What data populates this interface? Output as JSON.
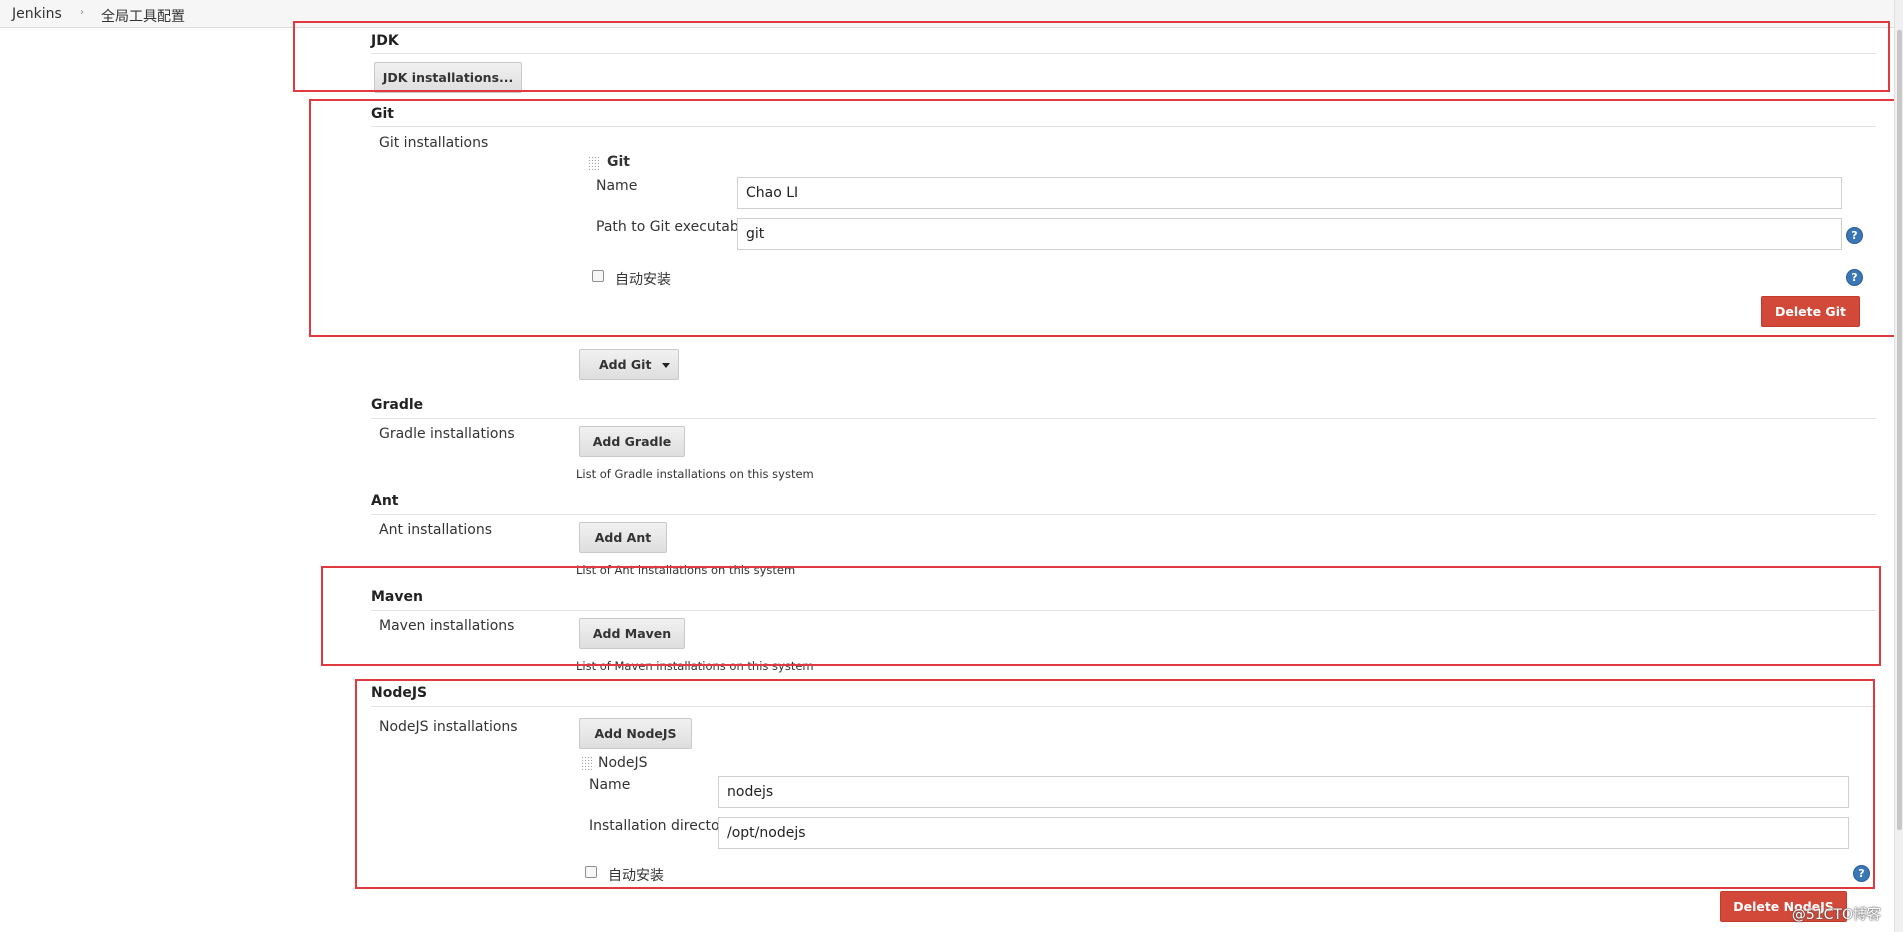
{
  "breadcrumb": {
    "items": [
      "Jenkins",
      "全局工具配置"
    ]
  },
  "jdk": {
    "title": "JDK",
    "button": "JDK installations..."
  },
  "git": {
    "title": "Git",
    "installations_label": "Git installations",
    "item_title": "Git",
    "name_label": "Name",
    "name_value": "Chao LI",
    "path_label": "Path to Git executable",
    "path_value": "git",
    "auto_install": "自动安装",
    "delete_button": "Delete Git",
    "add_button": "Add Git"
  },
  "gradle": {
    "title": "Gradle",
    "installations_label": "Gradle installations",
    "add_button": "Add Gradle",
    "description": "List of Gradle installations on this system"
  },
  "ant": {
    "title": "Ant",
    "installations_label": "Ant installations",
    "add_button": "Add Ant",
    "description": "List of Ant installations on this system"
  },
  "maven": {
    "title": "Maven",
    "installations_label": "Maven installations",
    "add_button": "Add Maven",
    "description": "List of Maven installations on this system"
  },
  "nodejs": {
    "title": "NodeJS",
    "installations_label": "NodeJS installations",
    "add_button": "Add NodeJS",
    "item_title": "NodeJS",
    "name_label": "Name",
    "name_value": "nodejs",
    "dir_label": "Installation directory",
    "dir_value": "/opt/nodejs",
    "auto_install": "自动安装",
    "delete_button": "Delete NodeJS"
  },
  "help_icon_glyph": "?",
  "watermark": "@51CTO博客",
  "colors": {
    "highlight": "#e0393e",
    "delete": "#d24939",
    "help": "#3a77b7"
  }
}
